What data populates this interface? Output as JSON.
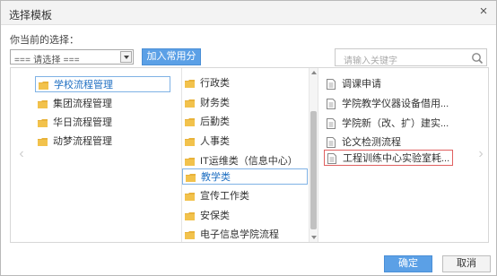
{
  "dialog": {
    "title": "选择模板",
    "close_glyph": "×"
  },
  "selection": {
    "current_label": "你当前的选择：",
    "select_value": "=== 请选择 ===",
    "add_button": "加入常用分类"
  },
  "search": {
    "placeholder": "请输入关键字"
  },
  "nav": {
    "left_glyph": "‹",
    "right_glyph": "›"
  },
  "columns": {
    "workflow_types": [
      {
        "label": "学校流程管理",
        "selected": true,
        "icon": "folder-icon"
      },
      {
        "label": "集团流程管理",
        "selected": false,
        "icon": "folder-icon"
      },
      {
        "label": "华日流程管理",
        "selected": false,
        "icon": "folder-icon"
      },
      {
        "label": "动梦流程管理",
        "selected": false,
        "icon": "folder-icon"
      }
    ],
    "categories": [
      {
        "label": "行政类",
        "selected": false,
        "icon": "folder-icon"
      },
      {
        "label": "财务类",
        "selected": false,
        "icon": "folder-icon"
      },
      {
        "label": "后勤类",
        "selected": false,
        "icon": "folder-icon"
      },
      {
        "label": "人事类",
        "selected": false,
        "icon": "folder-icon"
      },
      {
        "label": "IT运维类（信息中心）",
        "selected": false,
        "icon": "folder-icon"
      },
      {
        "label": "教学类",
        "selected": true,
        "icon": "folder-icon"
      },
      {
        "label": "宣传工作类",
        "selected": false,
        "icon": "folder-icon"
      },
      {
        "label": "安保类",
        "selected": false,
        "icon": "folder-icon"
      },
      {
        "label": "电子信息学院流程",
        "selected": false,
        "icon": "folder-icon"
      }
    ],
    "templates": [
      {
        "label": "调课申请",
        "selected": false,
        "icon": "document-icon"
      },
      {
        "label": "学院教学仪器设备借用...",
        "selected": false,
        "icon": "document-icon"
      },
      {
        "label": "学院新（改、扩）建实...",
        "selected": false,
        "icon": "document-icon"
      },
      {
        "label": "论文检测流程",
        "selected": false,
        "icon": "document-icon"
      },
      {
        "label": "工程训练中心实验室耗...",
        "selected": true,
        "icon": "document-icon"
      }
    ]
  },
  "footer": {
    "ok": "确定",
    "cancel": "取消"
  },
  "colors": {
    "accent": "#5ba0e6",
    "folder": "#e8b23a",
    "selected_outline": "#7fb2e5",
    "highlight_outline": "#e06060"
  }
}
